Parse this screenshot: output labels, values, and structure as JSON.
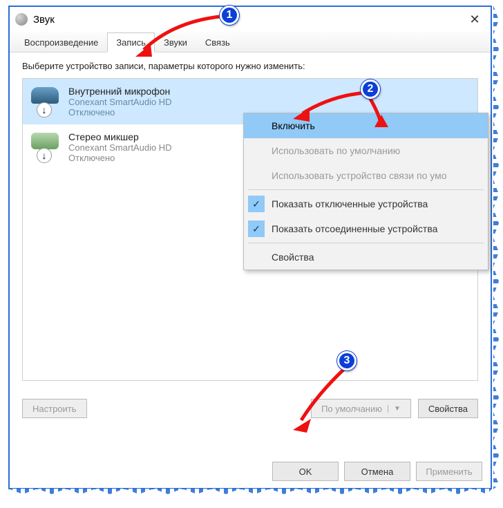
{
  "window": {
    "title": "Звук"
  },
  "tabs": [
    {
      "label": "Воспроизведение",
      "active": false
    },
    {
      "label": "Запись",
      "active": true
    },
    {
      "label": "Звуки",
      "active": false
    },
    {
      "label": "Связь",
      "active": false
    }
  ],
  "instruction": "Выберите устройство записи, параметры которого нужно изменить:",
  "devices": [
    {
      "name": "Внутренний микрофон",
      "vendor": "Conexant SmartAudio HD",
      "status": "Отключено",
      "selected": true
    },
    {
      "name": "Стерео микшер",
      "vendor": "Conexant SmartAudio HD",
      "status": "Отключено",
      "selected": false
    }
  ],
  "context_menu": {
    "items": [
      {
        "label": "Включить",
        "state": "highlight"
      },
      {
        "label": "Использовать по умолчанию",
        "state": "disabled"
      },
      {
        "label": "Использовать устройство связи по умо",
        "state": "disabled"
      },
      {
        "sep": true
      },
      {
        "label": "Показать отключенные устройства",
        "state": "checked"
      },
      {
        "label": "Показать отсоединенные устройства",
        "state": "checked"
      },
      {
        "sep": true
      },
      {
        "label": "Свойства",
        "state": "normal"
      }
    ]
  },
  "lower": {
    "configure": "Настроить",
    "default": "По умолчанию",
    "properties": "Свойства"
  },
  "dialog": {
    "ok": "OK",
    "cancel": "Отмена",
    "apply": "Применить"
  },
  "annotations": {
    "b1": "1",
    "b2": "2",
    "b3": "3"
  }
}
